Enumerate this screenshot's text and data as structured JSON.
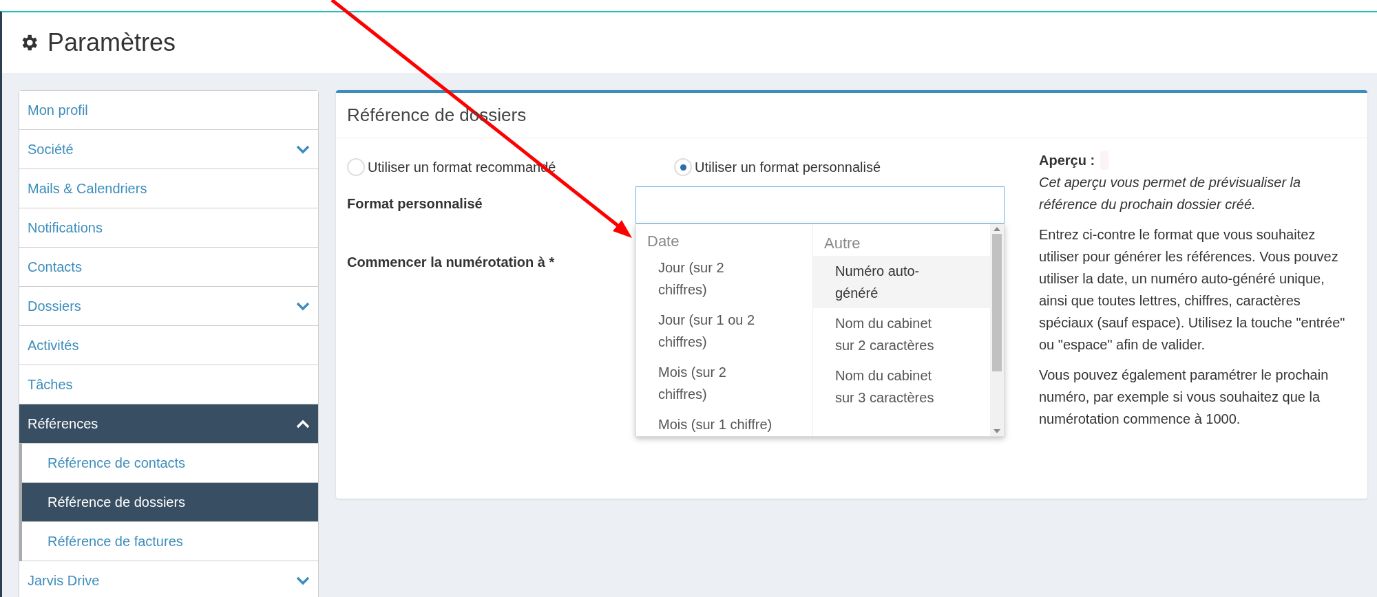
{
  "page": {
    "title": "Paramètres"
  },
  "sidebar": {
    "items": [
      {
        "label": "Mon profil",
        "selected": false
      },
      {
        "label": "Société",
        "selected": false,
        "expanded": false
      },
      {
        "label": "Mails & Calendriers",
        "selected": false
      },
      {
        "label": "Notifications",
        "selected": false
      },
      {
        "label": "Contacts",
        "selected": false
      },
      {
        "label": "Dossiers",
        "selected": false,
        "expanded": false
      },
      {
        "label": "Activités",
        "selected": false
      },
      {
        "label": "Tâches",
        "selected": false
      },
      {
        "label": "Références",
        "selected": true,
        "expanded": true,
        "children": [
          {
            "label": "Référence de contacts",
            "selected": false
          },
          {
            "label": "Référence de dossiers",
            "selected": true
          },
          {
            "label": "Référence de factures",
            "selected": false
          }
        ]
      },
      {
        "label": "Jarvis Drive",
        "selected": false,
        "expanded": false
      }
    ]
  },
  "panel": {
    "title": "Référence de dossiers",
    "format_options": [
      {
        "label": "Utiliser un format recommandé",
        "selected": false
      },
      {
        "label": "Utiliser un format personnalisé",
        "selected": true
      }
    ],
    "fields": [
      {
        "label": "Format personnalisé"
      },
      {
        "label": "Commencer la numérotation à *"
      }
    ],
    "dropdown": {
      "groups": [
        {
          "title": "Date",
          "items": [
            {
              "label": "Jour (sur 2 chiffres)",
              "highlighted": false
            },
            {
              "label": "Jour (sur 1 ou 2 chiffres)",
              "highlighted": false
            },
            {
              "label": "Mois (sur 2 chiffres)",
              "highlighted": false
            },
            {
              "label": "Mois (sur 1 chiffre)",
              "highlighted": false
            }
          ]
        },
        {
          "title": "Autre",
          "items": [
            {
              "label": "Numéro auto-généré",
              "highlighted": true
            },
            {
              "label": "Nom du cabinet sur 2 caractères",
              "highlighted": false
            },
            {
              "label": "Nom du cabinet sur 3 caractères",
              "highlighted": false
            }
          ]
        }
      ]
    },
    "preview": {
      "label": "Aperçu :",
      "note": "Cet aperçu vous permet de prévisualiser la référence du prochain dossier créé.",
      "paragraphs": [
        "Entrez ci-contre le format que vous souhaitez utiliser pour générer les références. Vous pouvez utiliser la date, un numéro auto-généré unique, ainsi que toutes lettres, chiffres, caractères spéciaux (sauf espace). Utilisez la touche \"entrée\" ou \"espace\" afin de valider.",
        "Vous pouvez également paramétrer le prochain numéro, par exemple si vous souhaitez que la numérotation commence à 1000."
      ]
    }
  }
}
